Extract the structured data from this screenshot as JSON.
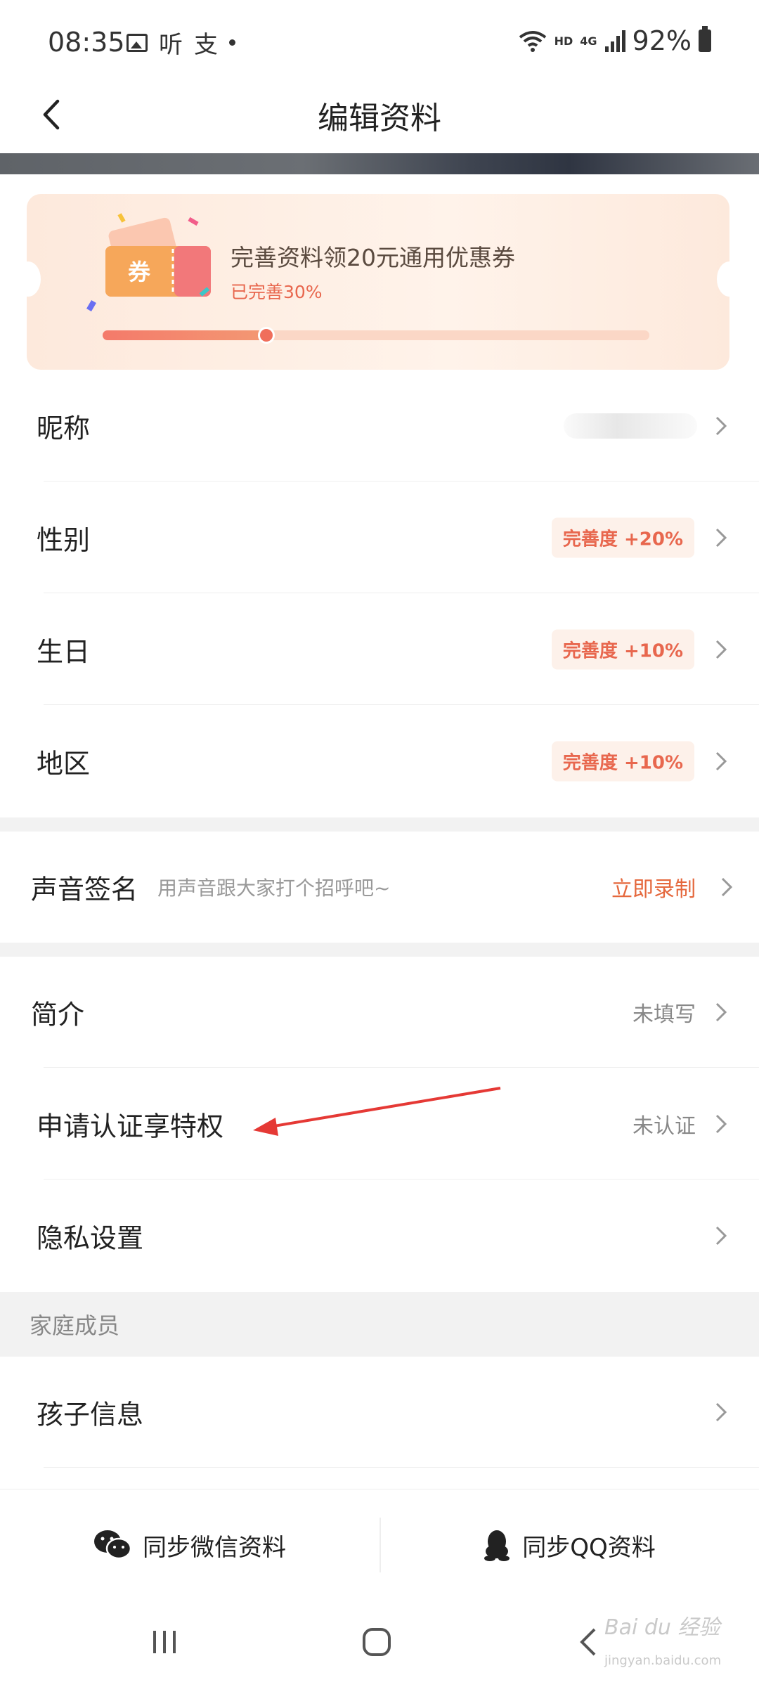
{
  "status_bar": {
    "time": "08:35",
    "left_glyphs": [
      "听",
      "支"
    ],
    "network_small": "HD",
    "network_gen": "4G",
    "battery": "92%"
  },
  "header": {
    "title": "编辑资料",
    "back_icon": "chevron-left-icon"
  },
  "promo": {
    "badge": "券",
    "title": "完善资料领20元通用优惠券",
    "progress_text": "已完善30%",
    "progress": 0.3
  },
  "rows_basic": [
    {
      "label": "昵称",
      "value": ""
    },
    {
      "label": "性别",
      "badge": "完善度 +20%"
    },
    {
      "label": "生日",
      "badge": "完善度 +10%"
    },
    {
      "label": "地区",
      "badge": "完善度 +10%"
    }
  ],
  "voice": {
    "label": "声音签名",
    "hint": "用声音跟大家打个招呼吧~",
    "action": "立即录制"
  },
  "rows_more": [
    {
      "label": "简介",
      "value": "未填写"
    },
    {
      "label": "申请认证享特权",
      "value": "未认证"
    },
    {
      "label": "隐私设置",
      "value": ""
    }
  ],
  "family": {
    "section_title": "家庭成员",
    "child_label": "孩子信息"
  },
  "sync": {
    "wechat": "同步微信资料",
    "qq": "同步QQ资料"
  },
  "watermark": {
    "brand": "Bai du 经验",
    "url": "jingyan.baidu.com"
  },
  "colors": {
    "accent": "#e5683d",
    "badge_text": "#e8674e",
    "promo_bg": "#fde9dc",
    "annotation_arrow": "#e53935"
  }
}
